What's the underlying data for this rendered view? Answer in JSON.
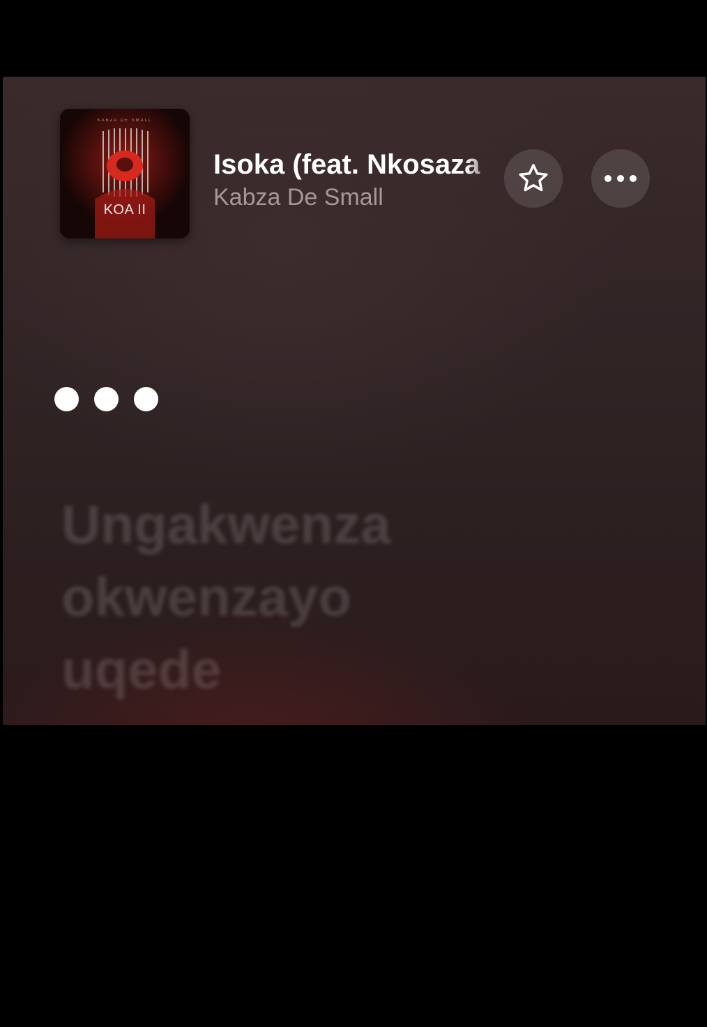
{
  "track": {
    "title": "Isoka (feat. Nkosaza",
    "artist": "Kabza De Small"
  },
  "album": {
    "cover_title": "KOA II",
    "cover_caption": "KABZA DE SMALL"
  },
  "actions": {
    "favorite_icon": "star-icon",
    "more_icon": "ellipsis-icon"
  },
  "lyrics": {
    "indicator_icon": "ellipsis-indicator",
    "lines": [
      "Ungakwenza",
      "okwenzayo",
      "uqede"
    ]
  },
  "colors": {
    "background": "#000000",
    "panel": "#32252",
    "accent_red": "#c4221c"
  }
}
